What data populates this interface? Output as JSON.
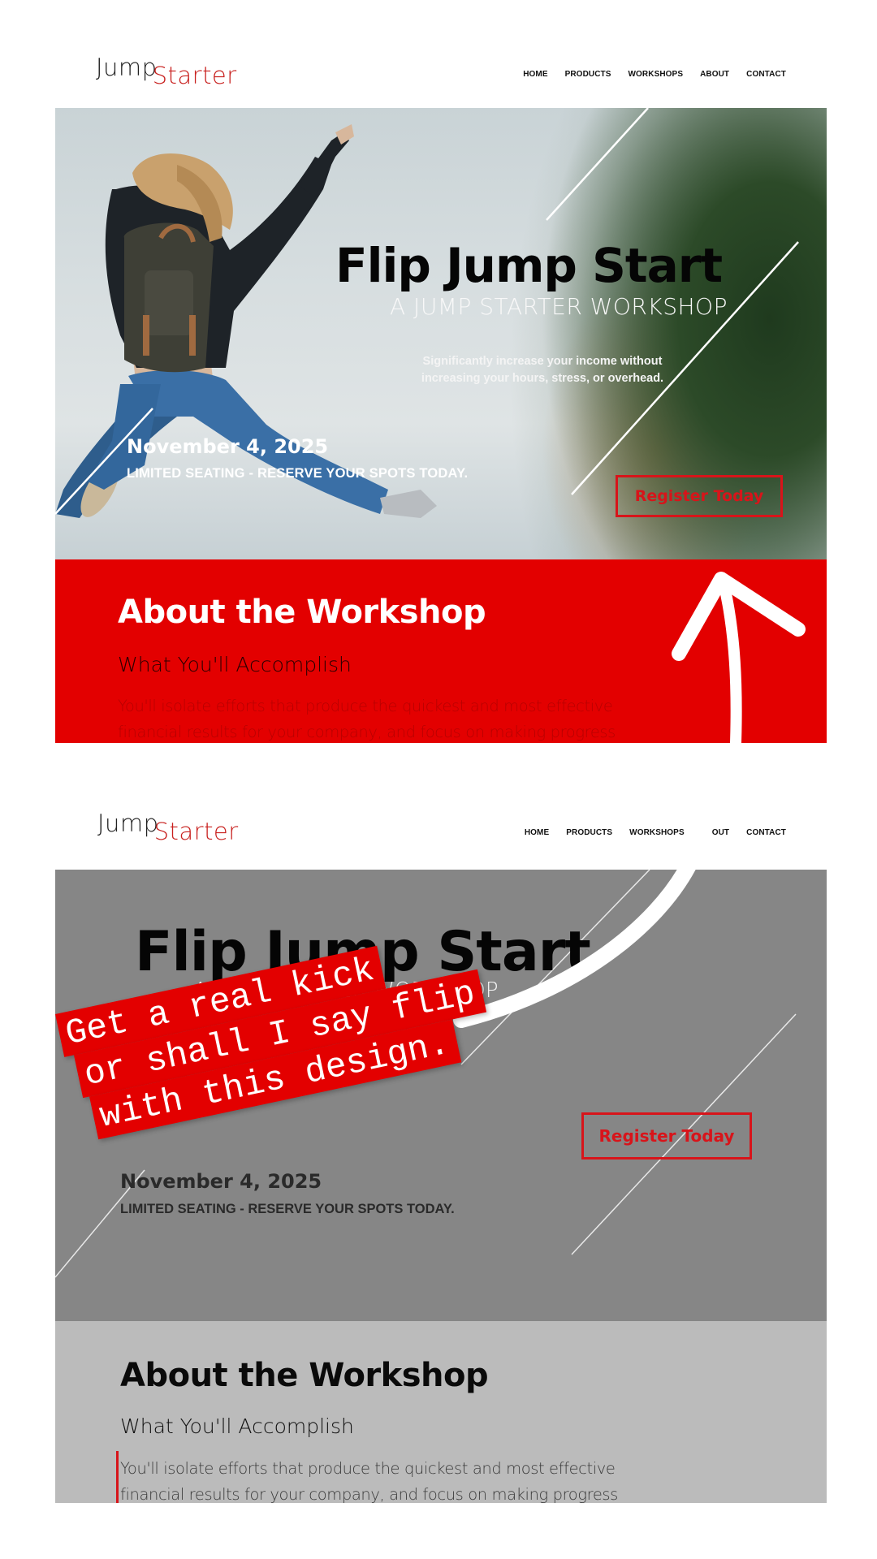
{
  "brand": {
    "logo_part1": "Jump",
    "logo_part2": "Starter",
    "accent_color": "#e30000",
    "logo_red": "#c8201e"
  },
  "mockups": [
    {
      "label": "original",
      "nav": [
        "HOME",
        "PRODUCTS",
        "WORKSHOPS",
        "ABOUT",
        "CONTACT"
      ],
      "hero": {
        "title": "Flip Jump Start",
        "subtitle": "A JUMP STARTER WORKSHOP",
        "tagline_line1": "Significantly increase your income without",
        "tagline_line2": "increasing your hours, stress, or overhead.",
        "date": "November 4, 2025",
        "seating": "LIMITED SEATING - RESERVE YOUR SPOTS TODAY.",
        "cta": "Register Today"
      },
      "about": {
        "heading": "About the Workshop",
        "subheading": "What You'll Accomplish",
        "body_line1": "You'll isolate efforts that produce the quickest and most effective",
        "body_line2": "financial results for your company, and focus on making progress"
      },
      "annotation": "arrow-up"
    },
    {
      "label": "redesign",
      "nav": [
        "HOME",
        "PRODUCTS",
        "WORKSHOPS",
        "OUT",
        "CONTACT"
      ],
      "hero": {
        "title": "Flip Jump Start",
        "subtitle": "A JUMP STARTER WORKSHOP",
        "date": "November 4, 2025",
        "seating": "LIMITED SEATING - RESERVE YOUR SPOTS TODAY.",
        "cta": "Register Today"
      },
      "sticker": {
        "line1": "Get a real kick",
        "line2": "or shall I say flip",
        "line3": "with this design."
      },
      "about": {
        "heading": "About the Workshop",
        "subheading": "What You'll Accomplish",
        "body_line1": "You'll isolate efforts that produce the quickest and most effective",
        "body_line2": "financial results for your company, and focus on making progress"
      },
      "annotation": "curved-swoosh"
    }
  ]
}
